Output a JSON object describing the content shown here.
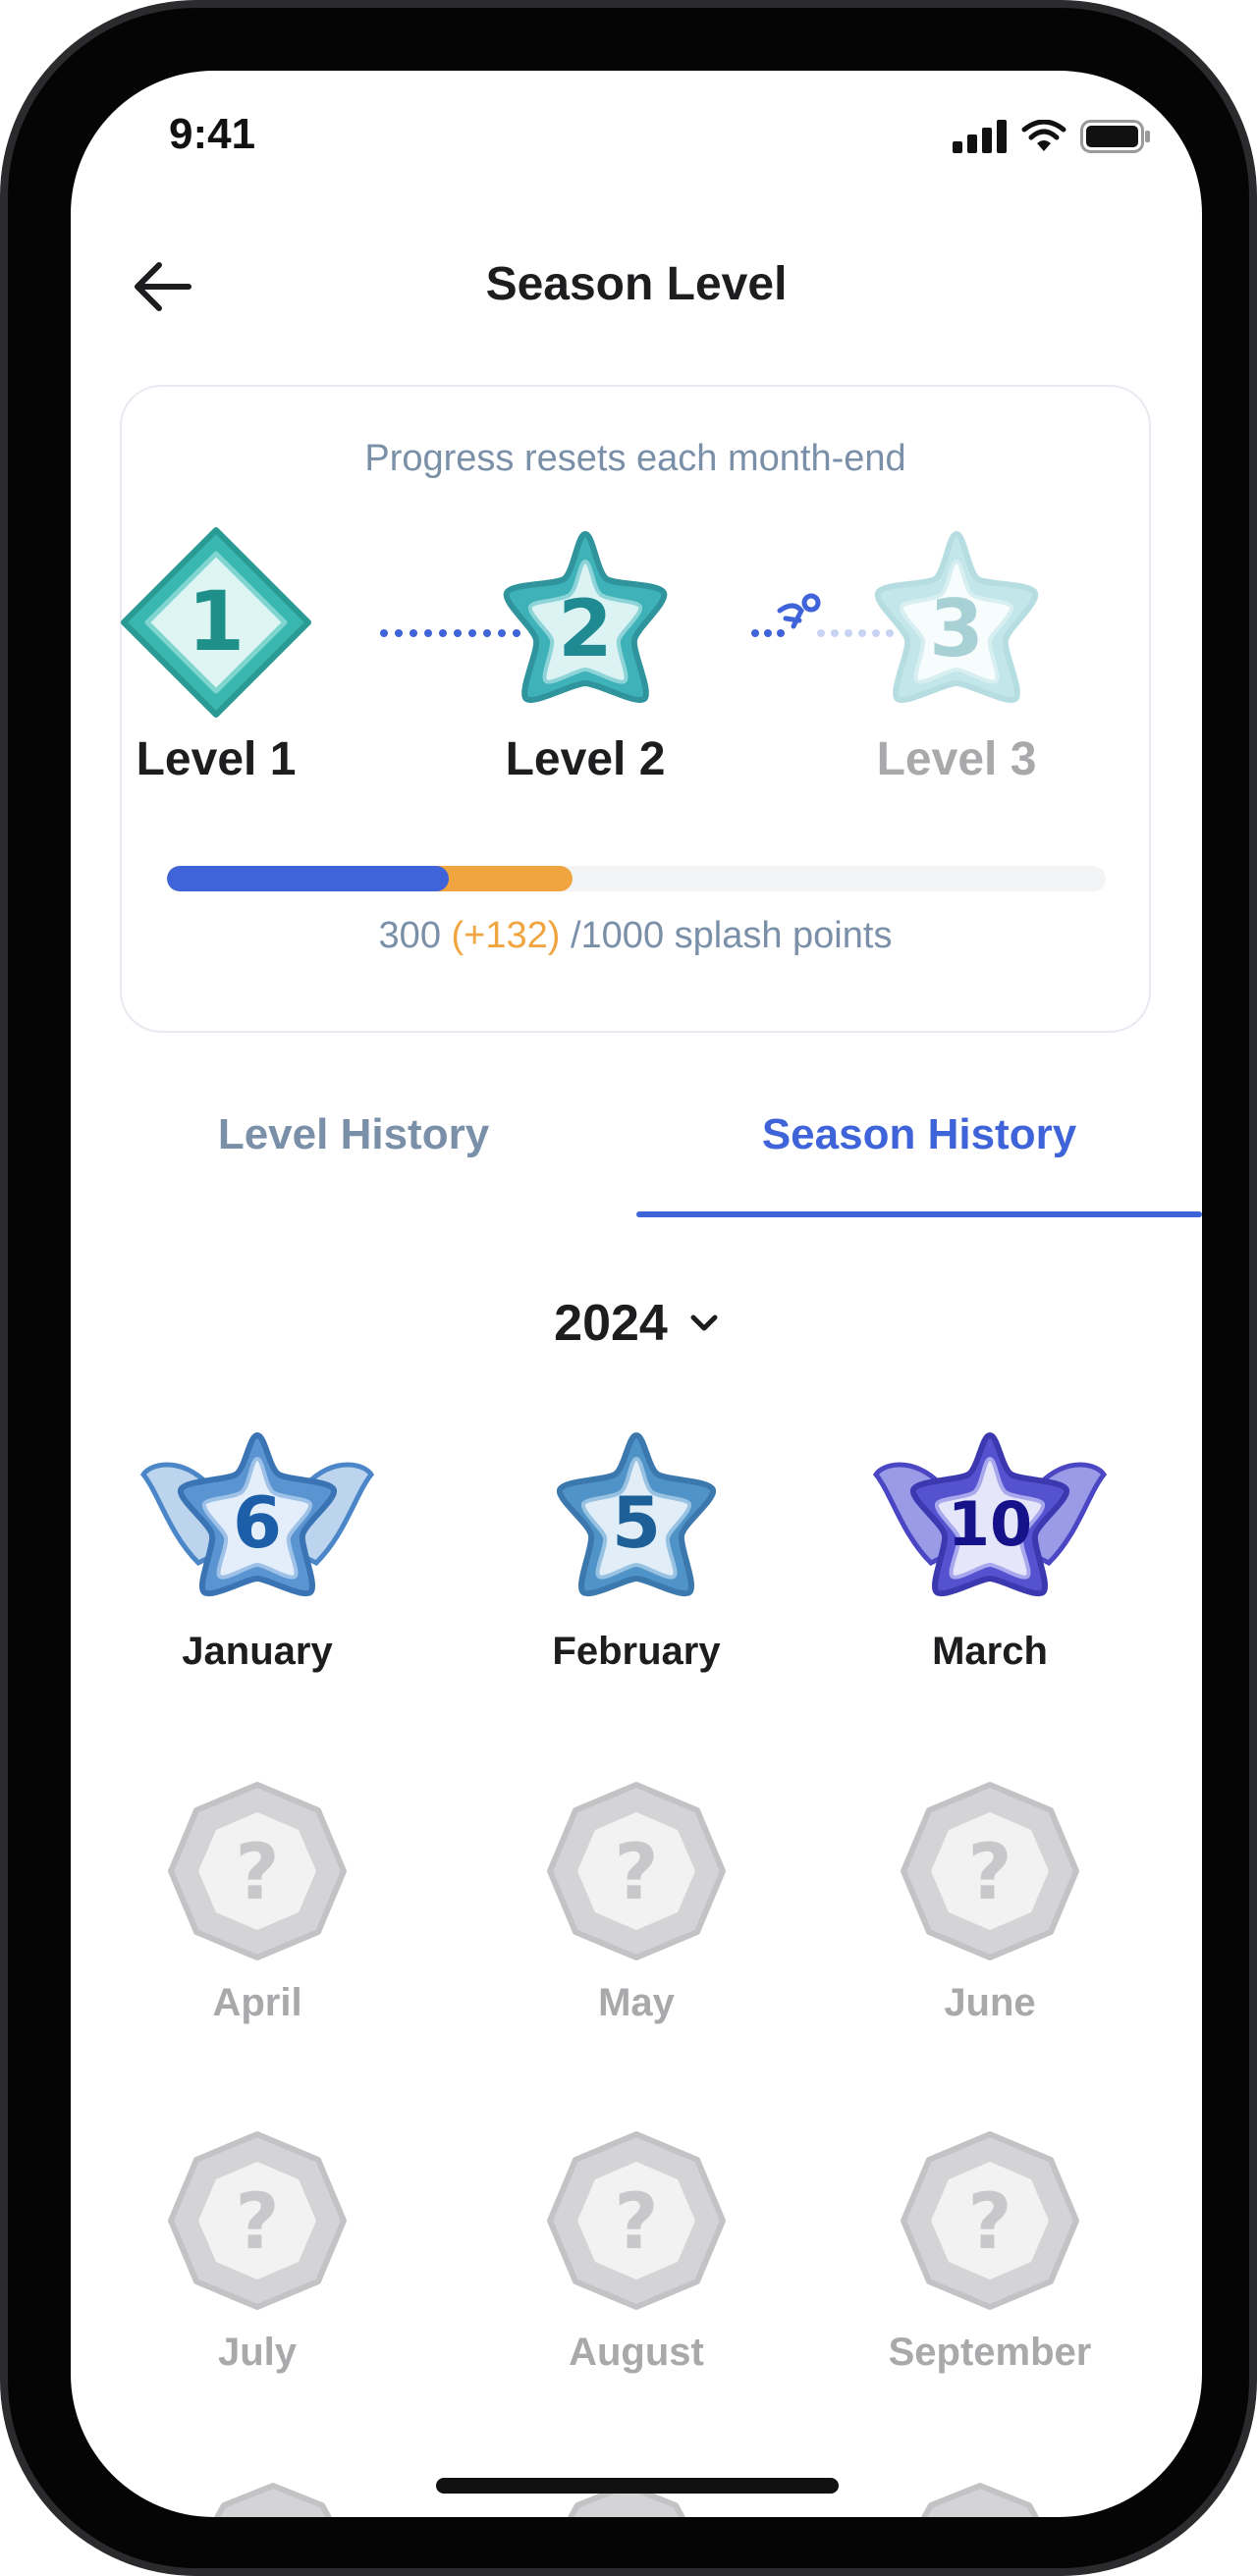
{
  "status": {
    "time": "9:41"
  },
  "header": {
    "title": "Season Level",
    "back_icon": "arrow-left-icon"
  },
  "progress_card": {
    "note": "Progress resets each month-end",
    "levels": [
      {
        "number": "1",
        "label": "Level 1",
        "state": "achieved"
      },
      {
        "number": "2",
        "label": "Level 2",
        "state": "current"
      },
      {
        "number": "3",
        "label": "Level 3",
        "state": "locked"
      }
    ],
    "points_current": "300",
    "points_gain": "(+132)",
    "points_total": "/1000 splash points",
    "progress_fraction": 0.3,
    "gain_fraction": 0.132,
    "colors": {
      "progress": "#3f63d8",
      "gain": "#f1a540"
    }
  },
  "tabs": [
    {
      "label": "Level History",
      "active": false
    },
    {
      "label": "Season History",
      "active": true
    }
  ],
  "year_selector": {
    "value": "2024",
    "icon": "chevron-down-icon"
  },
  "months": [
    {
      "label": "January",
      "badge": "6",
      "state": "earned-winged"
    },
    {
      "label": "February",
      "badge": "5",
      "state": "earned-star"
    },
    {
      "label": "March",
      "badge": "10",
      "state": "earned-winged-purple"
    },
    {
      "label": "April",
      "badge": "?",
      "state": "locked"
    },
    {
      "label": "May",
      "badge": "?",
      "state": "locked"
    },
    {
      "label": "June",
      "badge": "?",
      "state": "locked"
    },
    {
      "label": "July",
      "badge": "?",
      "state": "locked"
    },
    {
      "label": "August",
      "badge": "?",
      "state": "locked"
    },
    {
      "label": "September",
      "badge": "?",
      "state": "locked"
    }
  ]
}
